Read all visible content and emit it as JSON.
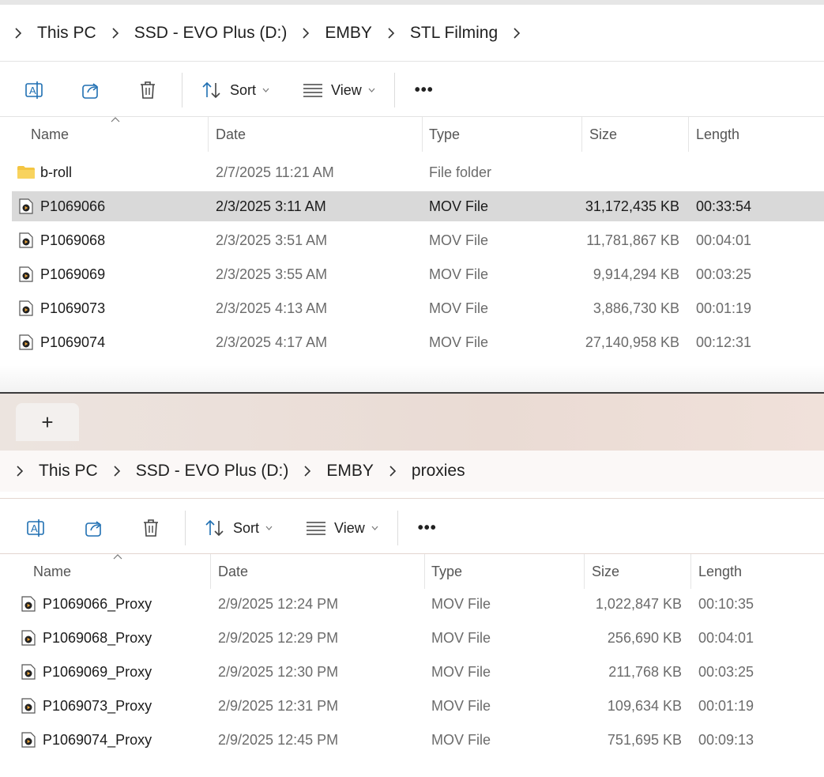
{
  "window1": {
    "breadcrumb": [
      "This PC",
      "SSD - EVO Plus (D:)",
      "EMBY",
      "STL Filming"
    ],
    "toolbar": {
      "sort_label": "Sort",
      "view_label": "View",
      "more_label": "•••"
    },
    "columns": {
      "name": "Name",
      "date": "Date",
      "type": "Type",
      "size": "Size",
      "length": "Length"
    },
    "rows": [
      {
        "icon": "folder-icon",
        "name": "b-roll",
        "date": "2/7/2025 11:21 AM",
        "type": "File folder",
        "size": "",
        "length": "",
        "selected": false
      },
      {
        "icon": "video-file-icon",
        "name": "P1069066",
        "date": "2/3/2025 3:11 AM",
        "type": "MOV File",
        "size": "31,172,435 KB",
        "length": "00:33:54",
        "selected": true
      },
      {
        "icon": "video-file-icon",
        "name": "P1069068",
        "date": "2/3/2025 3:51 AM",
        "type": "MOV File",
        "size": "11,781,867 KB",
        "length": "00:04:01",
        "selected": false
      },
      {
        "icon": "video-file-icon",
        "name": "P1069069",
        "date": "2/3/2025 3:55 AM",
        "type": "MOV File",
        "size": "9,914,294 KB",
        "length": "00:03:25",
        "selected": false
      },
      {
        "icon": "video-file-icon",
        "name": "P1069073",
        "date": "2/3/2025 4:13 AM",
        "type": "MOV File",
        "size": "3,886,730 KB",
        "length": "00:01:19",
        "selected": false
      },
      {
        "icon": "video-file-icon",
        "name": "P1069074",
        "date": "2/3/2025 4:17 AM",
        "type": "MOV File",
        "size": "27,140,958 KB",
        "length": "00:12:31",
        "selected": false
      }
    ]
  },
  "window2": {
    "new_tab_label": "+",
    "breadcrumb": [
      "This PC",
      "SSD - EVO Plus (D:)",
      "EMBY",
      "proxies"
    ],
    "toolbar": {
      "sort_label": "Sort",
      "view_label": "View",
      "more_label": "•••"
    },
    "columns": {
      "name": "Name",
      "date": "Date",
      "type": "Type",
      "size": "Size",
      "length": "Length"
    },
    "rows": [
      {
        "icon": "video-file-icon",
        "name": "P1069066_Proxy",
        "date": "2/9/2025 12:24 PM",
        "type": "MOV File",
        "size": "1,022,847 KB",
        "length": "00:10:35"
      },
      {
        "icon": "video-file-icon",
        "name": "P1069068_Proxy",
        "date": "2/9/2025 12:29 PM",
        "type": "MOV File",
        "size": "256,690 KB",
        "length": "00:04:01"
      },
      {
        "icon": "video-file-icon",
        "name": "P1069069_Proxy",
        "date": "2/9/2025 12:30 PM",
        "type": "MOV File",
        "size": "211,768 KB",
        "length": "00:03:25"
      },
      {
        "icon": "video-file-icon",
        "name": "P1069073_Proxy",
        "date": "2/9/2025 12:31 PM",
        "type": "MOV File",
        "size": "109,634 KB",
        "length": "00:01:19"
      },
      {
        "icon": "video-file-icon",
        "name": "P1069074_Proxy",
        "date": "2/9/2025 12:45 PM",
        "type": "MOV File",
        "size": "751,695 KB",
        "length": "00:09:13"
      }
    ]
  },
  "colors": {
    "selected_row": "#d9d9d9",
    "accent_blue": "#1f6fb2",
    "folder": "#f4c542"
  }
}
